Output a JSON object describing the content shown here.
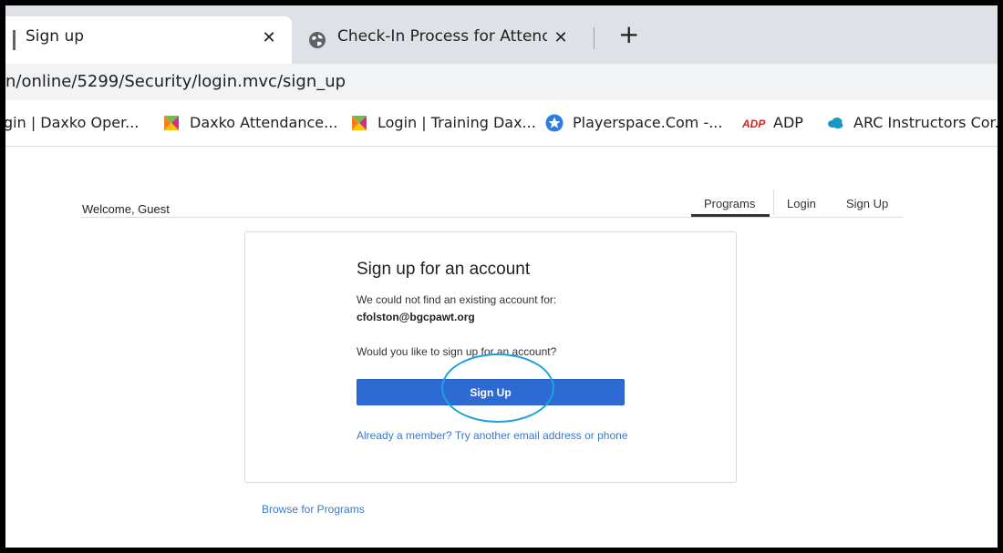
{
  "browser": {
    "tabs": [
      {
        "title": "Sign up",
        "close": "✕",
        "active": true
      },
      {
        "title": "Check-In Process for Attendance",
        "close": "✕",
        "icon": "globe-icon",
        "active": false
      }
    ],
    "new_tab": "+",
    "url": "n/online/5299/Security/login.mvc/sign_up",
    "bookmarks": [
      {
        "label": "gin | Daxko Oper...",
        "icon": null
      },
      {
        "label": "Daxko Attendance...",
        "icon": "daxko-icon"
      },
      {
        "label": "Login | Training Dax...",
        "icon": "daxko-icon"
      },
      {
        "label": "Playerspace.Com -...",
        "icon": "playerspace-icon"
      },
      {
        "label": "ADP",
        "icon": "adp-icon"
      },
      {
        "label": "ARC Instructors Cor...",
        "icon": "salesforce-cloud-icon"
      }
    ],
    "colors": {
      "tab_strip": "#dee1e6",
      "url_bar": "#f1f3f4"
    }
  },
  "page": {
    "welcome": "Welcome, Guest",
    "nav": [
      {
        "label": "Programs",
        "active": true
      },
      {
        "label": "Login",
        "active": false
      },
      {
        "label": "Sign Up",
        "active": false
      }
    ],
    "card": {
      "title": "Sign up for an account",
      "not_found": "We could not find an existing account for:",
      "email": "cfolston@bgcpawt.org",
      "question": "Would you like to sign up for an account?",
      "button": "Sign Up",
      "alt_link": "Already a member? Try another email address or phone"
    },
    "browse_link": "Browse for Programs",
    "colors": {
      "primary_button": "#2e6ad3",
      "link": "#3b78c8",
      "annotation_ring": "#1aa3dd"
    }
  }
}
